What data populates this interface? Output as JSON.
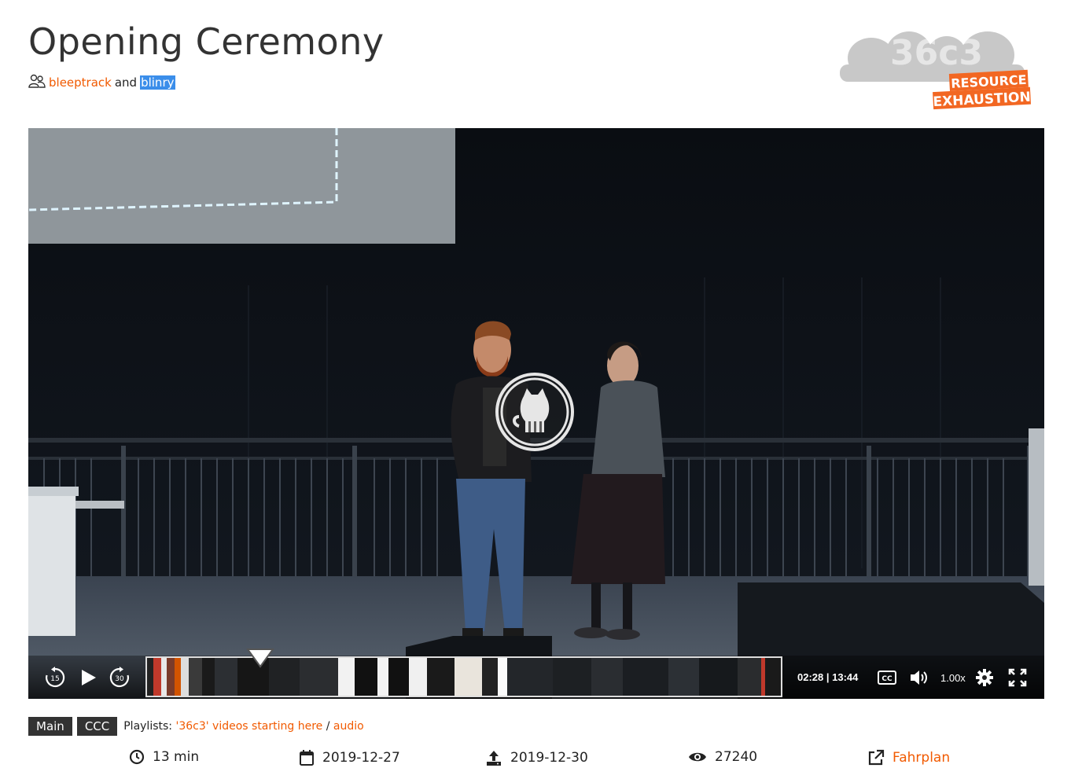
{
  "header": {
    "title": "Opening Ceremony",
    "persons": [
      "bleeptrack",
      "blinry"
    ],
    "persons_joiner": "and",
    "logo_text_main": "36c3",
    "logo_text_badge_1": "RESOURCE",
    "logo_text_badge_2": "EXHAUSTION"
  },
  "player": {
    "time_current": "02:28",
    "time_sep": "|",
    "time_total": "13:44",
    "skip_back_label": "15",
    "skip_forward_label": "30",
    "cc_label": "CC",
    "speed": "1.00x",
    "progress_fraction": 0.18
  },
  "tags": [
    "Main",
    "CCC"
  ],
  "playlists": {
    "label": "Playlists:",
    "items": [
      "'36c3' videos starting here",
      "audio"
    ],
    "separator": "/"
  },
  "stats": {
    "duration": "13 min",
    "date": "2019-12-27",
    "release_date": "2019-12-30",
    "views": "27240",
    "fahrplan": "Fahrplan"
  },
  "colors": {
    "accent": "#f15a00",
    "selection": "#3b8eea",
    "tag_bg": "#333333"
  }
}
